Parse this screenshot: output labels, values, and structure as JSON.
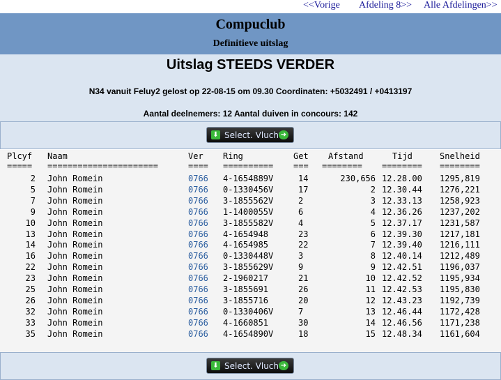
{
  "nav": {
    "prev": "<<Vorige",
    "afdeling": "Afdeling 8>>",
    "all": "Alle Afdelingen>>"
  },
  "header": {
    "club": "Compuclub",
    "subtitle": "Definitieve uitslag"
  },
  "info": {
    "title": "Uitslag STEEDS VERDER",
    "race": "N34 vanuit Feluy2 gelost op 22-08-15 om 09.30 Coordinaten: +5032491 / +0413197",
    "participants": "Aantal deelnemers: 12 Aantal duiven in concours: 142"
  },
  "button": {
    "label": "Select. Vlucht",
    "left_icon": "download-icon",
    "right_icon": "arrow-right-icon",
    "accent": "#3ab83a"
  },
  "table": {
    "headers": {
      "plcyf": "Plcyf",
      "naam": "Naam",
      "ver": "Ver",
      "ring": "Ring",
      "get": "Get",
      "afstand": "Afstand",
      "tijd": "Tijd",
      "snelheid": "Snelheid"
    },
    "separators": {
      "plcyf": "=====",
      "naam": "======================",
      "ver": "====",
      "ring": "==========",
      "get": "===",
      "afstand": "========",
      "tijd": "========",
      "snelheid": "========"
    },
    "rows": [
      {
        "plcyf": "2",
        "naam": "John Romein",
        "ver": "0766",
        "ring": "4-1654889V",
        "get": "14",
        "afstand": "230,656",
        "tijd": "12.28.00",
        "snelheid": "1295,819"
      },
      {
        "plcyf": "5",
        "naam": "John Romein",
        "ver": "0766",
        "ring": "0-1330456V",
        "get": "17",
        "afstand": "2",
        "tijd": "12.30.44",
        "snelheid": "1276,221"
      },
      {
        "plcyf": "7",
        "naam": "John Romein",
        "ver": "0766",
        "ring": "3-1855562V",
        "get": "2",
        "afstand": "3",
        "tijd": "12.33.13",
        "snelheid": "1258,923"
      },
      {
        "plcyf": "9",
        "naam": "John Romein",
        "ver": "0766",
        "ring": "1-1400055V",
        "get": "6",
        "afstand": "4",
        "tijd": "12.36.26",
        "snelheid": "1237,202"
      },
      {
        "plcyf": "10",
        "naam": "John Romein",
        "ver": "0766",
        "ring": "3-1855582V",
        "get": "4",
        "afstand": "5",
        "tijd": "12.37.17",
        "snelheid": "1231,587"
      },
      {
        "plcyf": "13",
        "naam": "John Romein",
        "ver": "0766",
        "ring": "4-1654948",
        "get": "23",
        "afstand": "6",
        "tijd": "12.39.30",
        "snelheid": "1217,181"
      },
      {
        "plcyf": "14",
        "naam": "John Romein",
        "ver": "0766",
        "ring": "4-1654985",
        "get": "22",
        "afstand": "7",
        "tijd": "12.39.40",
        "snelheid": "1216,111"
      },
      {
        "plcyf": "16",
        "naam": "John Romein",
        "ver": "0766",
        "ring": "0-1330448V",
        "get": "3",
        "afstand": "8",
        "tijd": "12.40.14",
        "snelheid": "1212,489"
      },
      {
        "plcyf": "22",
        "naam": "John Romein",
        "ver": "0766",
        "ring": "3-1855629V",
        "get": "9",
        "afstand": "9",
        "tijd": "12.42.51",
        "snelheid": "1196,037"
      },
      {
        "plcyf": "23",
        "naam": "John Romein",
        "ver": "0766",
        "ring": "2-1960217",
        "get": "21",
        "afstand": "10",
        "tijd": "12.42.52",
        "snelheid": "1195,934"
      },
      {
        "plcyf": "25",
        "naam": "John Romein",
        "ver": "0766",
        "ring": "3-1855691",
        "get": "26",
        "afstand": "11",
        "tijd": "12.42.53",
        "snelheid": "1195,830"
      },
      {
        "plcyf": "26",
        "naam": "John Romein",
        "ver": "0766",
        "ring": "3-1855716",
        "get": "20",
        "afstand": "12",
        "tijd": "12.43.23",
        "snelheid": "1192,739"
      },
      {
        "plcyf": "32",
        "naam": "John Romein",
        "ver": "0766",
        "ring": "0-1330406V",
        "get": "7",
        "afstand": "13",
        "tijd": "12.46.44",
        "snelheid": "1172,428"
      },
      {
        "plcyf": "33",
        "naam": "John Romein",
        "ver": "0766",
        "ring": "4-1660851",
        "get": "30",
        "afstand": "14",
        "tijd": "12.46.56",
        "snelheid": "1171,238"
      },
      {
        "plcyf": "35",
        "naam": "John Romein",
        "ver": "0766",
        "ring": "4-1654890V",
        "get": "18",
        "afstand": "15",
        "tijd": "12.48.34",
        "snelheid": "1161,604"
      }
    ]
  },
  "colors": {
    "header_bg": "#7096c4",
    "panel_bg": "#dbe5f1",
    "link": "#1a1a99",
    "ver_link": "#2a5d9f"
  }
}
